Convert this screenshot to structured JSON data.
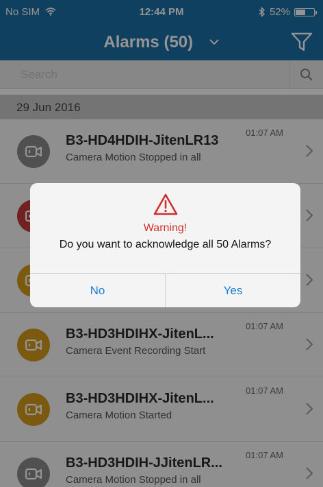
{
  "status_bar": {
    "carrier": "No SIM",
    "time": "12:44 PM",
    "battery": "52%",
    "battery_level": 0.52
  },
  "header": {
    "title": "Alarms (50)"
  },
  "search": {
    "placeholder": "Search",
    "value": ""
  },
  "date_section": "29 Jun 2016",
  "alarms": [
    {
      "title": "B3-HD4HDIH-JitenLR13",
      "subtitle": "Camera Motion Stopped in all",
      "time": "01:07 AM",
      "color": "#8a8a8a"
    },
    {
      "title": "",
      "subtitle": "",
      "time": "",
      "color": "#c43a3a"
    },
    {
      "title": "",
      "subtitle": "",
      "time": "",
      "color": "#d49b1c"
    },
    {
      "title": "B3-HD3HDIHX-JitenL...",
      "subtitle": "Camera Event Recording Start",
      "time": "01:07 AM",
      "color": "#d49b1c"
    },
    {
      "title": "B3-HD3HDIHX-JitenL...",
      "subtitle": "Camera Motion Started",
      "time": "01:07 AM",
      "color": "#d49b1c"
    },
    {
      "title": "B3-HD3HDIH-JJitenLR...",
      "subtitle": "Camera Motion Stopped in all",
      "time": "01:07 AM",
      "color": "#8a8a8a"
    }
  ],
  "dialog": {
    "title": "Warning!",
    "message": "Do you want to acknowledge all 50 Alarms?",
    "no_label": "No",
    "yes_label": "Yes"
  },
  "icons": {
    "wifi": "wifi-icon",
    "bluetooth": "bluetooth-icon",
    "battery": "battery-icon",
    "dropdown": "chevron-down-icon",
    "filter": "filter-icon",
    "search": "search-icon",
    "camera": "camera-icon",
    "chevron": "chevron-right-icon",
    "warning": "warning-icon"
  },
  "colors": {
    "brand": "#1d6fa5",
    "warning": "#d0312d",
    "action": "#1a7bd4"
  }
}
